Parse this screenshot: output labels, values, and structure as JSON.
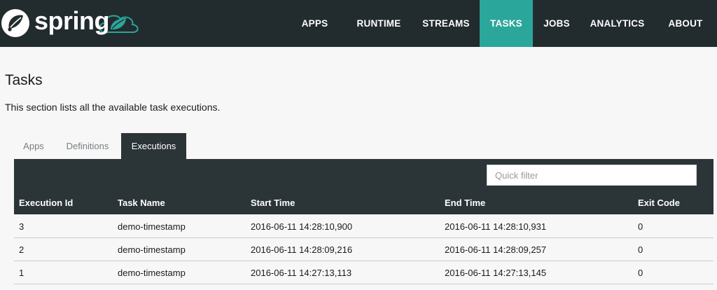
{
  "brand": {
    "name": "spring"
  },
  "nav": {
    "items": [
      {
        "label": "APPS",
        "active": false
      },
      {
        "label": "RUNTIME",
        "active": false
      },
      {
        "label": "STREAMS",
        "active": false
      },
      {
        "label": "TASKS",
        "active": true
      },
      {
        "label": "JOBS",
        "active": false
      },
      {
        "label": "ANALYTICS",
        "active": false
      },
      {
        "label": "ABOUT",
        "active": false
      }
    ]
  },
  "page": {
    "title": "Tasks",
    "description": "This section lists all the available task executions."
  },
  "tabs": [
    {
      "label": "Apps",
      "active": false
    },
    {
      "label": "Definitions",
      "active": false
    },
    {
      "label": "Executions",
      "active": true
    }
  ],
  "filter": {
    "placeholder": "Quick filter",
    "value": ""
  },
  "table": {
    "columns": [
      "Execution Id",
      "Task Name",
      "Start Time",
      "End Time",
      "Exit Code"
    ],
    "rows": [
      [
        "3",
        "demo-timestamp",
        "2016-06-11 14:28:10,900",
        "2016-06-11 14:28:10,931",
        "0"
      ],
      [
        "2",
        "demo-timestamp",
        "2016-06-11 14:28:09,216",
        "2016-06-11 14:28:09,257",
        "0"
      ],
      [
        "1",
        "demo-timestamp",
        "2016-06-11 14:27:13,113",
        "2016-06-11 14:27:13,145",
        "0"
      ]
    ]
  },
  "colors": {
    "navbar": "#222b2e",
    "accent": "#2aa69a",
    "dark_panel": "#2b3437",
    "page_bg": "#f7f7f7"
  }
}
